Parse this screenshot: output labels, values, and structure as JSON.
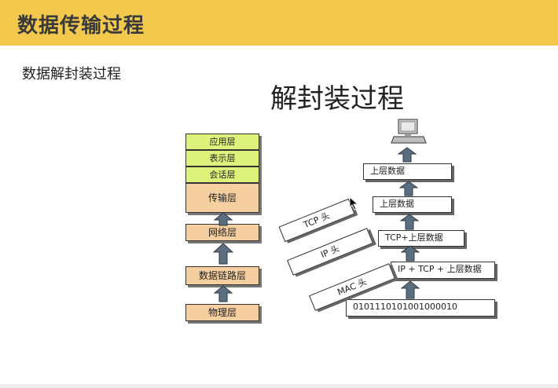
{
  "header": {
    "title": "数据传输过程"
  },
  "slide": {
    "subtitle": "数据解封装过程",
    "diagram_title": "解封装过程"
  },
  "osi_layers": {
    "application": "应用层",
    "presentation": "表示层",
    "session": "会话层",
    "transport": "传输层",
    "network": "网络层",
    "datalink": "数据链路层",
    "physical": "物理层"
  },
  "decap": {
    "bits": "0101110101001000010",
    "ip_tcp_data": "IP + TCP + 上层数据",
    "tcp_data": "TCP+上层数据",
    "upper_data_1": "上层数据",
    "upper_data_2": "上层数据",
    "mac_header": "MAC 头",
    "ip_header": "IP 头",
    "tcp_header": "TCP 头"
  },
  "icons": [
    "computer-icon",
    "up-arrow-icon",
    "cursor-icon"
  ]
}
